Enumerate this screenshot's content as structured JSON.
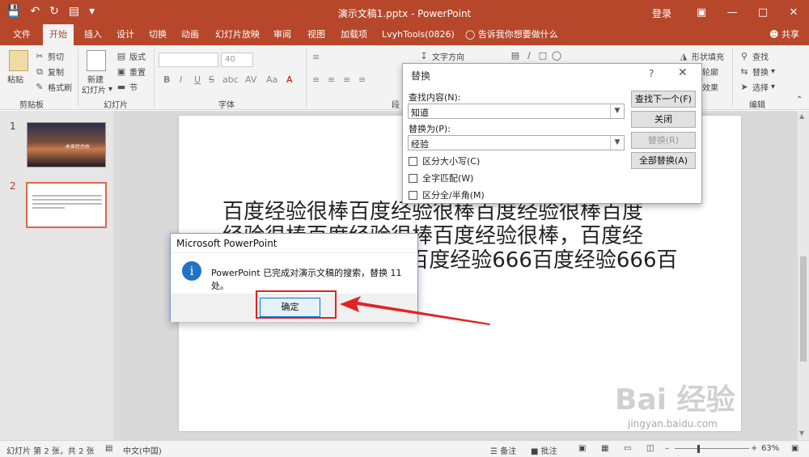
{
  "titlebar": {
    "title": "演示文稿1.pptx - PowerPoint",
    "login": "登录",
    "restore_icon": "ribbon-display-icon",
    "colors": {
      "accent": "#b7472a"
    }
  },
  "tabs": [
    {
      "label": "文件"
    },
    {
      "label": "开始"
    },
    {
      "label": "插入"
    },
    {
      "label": "设计"
    },
    {
      "label": "切换"
    },
    {
      "label": "动画"
    },
    {
      "label": "幻灯片放映"
    },
    {
      "label": "审阅"
    },
    {
      "label": "视图"
    },
    {
      "label": "加载项"
    },
    {
      "label": "LvyhTools(0826)"
    }
  ],
  "tellme": "告诉我你想要做什么",
  "share": "共享",
  "ribbon": {
    "clipboard": {
      "paste": "粘贴",
      "cut": "剪切",
      "copy": "复制",
      "format_painter": "格式刷",
      "label": "剪贴板"
    },
    "slides": {
      "new_slide_1": "新建",
      "new_slide_2": "幻灯片",
      "layout": "版式",
      "reset": "重置",
      "section": "节",
      "label": "幻灯片"
    },
    "font": {
      "size": "40",
      "bold": "B",
      "italic": "I",
      "underline": "U",
      "strike": "S",
      "label": "字体"
    },
    "paragraph": {
      "text_direction": "文字方向",
      "label": "段"
    },
    "drawing": {
      "shape_fill": "形状填充",
      "shape_outline": "轮廓",
      "shape_effects": "效果"
    },
    "editing": {
      "find": "查找",
      "replace": "替换",
      "select": "选择",
      "label": "编辑"
    }
  },
  "slides_panel": {
    "slide1": {
      "number": "1",
      "title_text": "未来的方向"
    },
    "slide2": {
      "number": "2"
    }
  },
  "slide": {
    "line1": "百度经验很棒百度经验很棒百度经验很棒百度",
    "line2": "经验很棒百度经验很棒百度经验很棒，百度经",
    "line3": "验666百度经验666百度经验666百度经验666百"
  },
  "replace_dialog": {
    "title": "替换",
    "help": "?",
    "find_label": "查找内容(N):",
    "find_value": "知道",
    "replace_label": "替换为(P):",
    "replace_value": "经验",
    "match_case": "区分大小写(C)",
    "whole_word": "全字匹配(W)",
    "width_match": "区分全/半角(M)",
    "find_next": "查找下一个(F)",
    "close": "关闭",
    "replace": "替换(R)",
    "replace_all": "全部替换(A)"
  },
  "message_box": {
    "title": "Microsoft PowerPoint",
    "message": "PowerPoint 已完成对演示文稿的搜索，替换 11 处。",
    "ok": "确定",
    "icon": "info-icon"
  },
  "statusbar": {
    "slide_info": "幻灯片 第 2 张，共 2 张",
    "language": "中文(中国)",
    "notes": "备注",
    "comments": "批注",
    "zoom": "63%"
  },
  "watermark": {
    "brand": "Bai  经验",
    "url": "jingyan.baidu.com"
  }
}
